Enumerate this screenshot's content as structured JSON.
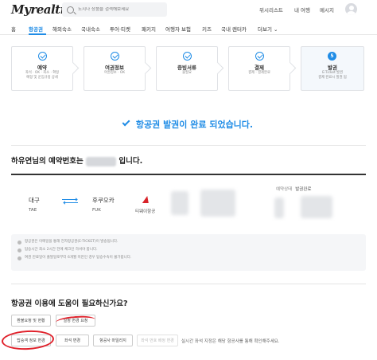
{
  "header": {
    "logo": "Myrealtrip",
    "search_placeholder": "도시나 상품을 검색해보세요",
    "links": [
      "위시리스트",
      "내 여행",
      "메시지"
    ]
  },
  "nav": {
    "items": [
      "홈",
      "항공권",
      "해외숙소",
      "국내숙소",
      "투어·티켓",
      "패키지",
      "여행자 보험",
      "키즈",
      "국내 렌터카",
      "더보기 ⌄"
    ],
    "active_index": 1
  },
  "steps": [
    {
      "title": "예약",
      "sub": "좌석 · OK · 최소 · 확정\n예형 및 운임규정 상세",
      "state": "done"
    },
    {
      "title": "여권정보",
      "sub": "여권정보 · OK",
      "state": "done"
    },
    {
      "title": "증빙서류",
      "sub": "불필요",
      "state": "done"
    },
    {
      "title": "결제",
      "sub": "결제 · 결제완료",
      "state": "done"
    },
    {
      "title": "발권",
      "sub": "E-Ticket 발권\n결제 완료시 발권 됨",
      "state": "current",
      "marker": "5"
    }
  ],
  "complete_message": "항공권 발권이 완료 되었습니다.",
  "reservation": {
    "title_prefix": "하유연님의 예약번호는",
    "title_suffix": "입니다.",
    "status_label": "예약상태",
    "status_value": "발권완료",
    "from_city": "대구",
    "from_code": "TAE",
    "to_city": "후쿠오카",
    "to_code": "FUK",
    "airline": "티웨이항공"
  },
  "notices": [
    "항공권은 이메일을 통해 전자항공권(E-TICKET)이 발송됩니다.",
    "탑승시간 최소 2시간 전에 체크인 하셔야 합니다.",
    "여권 만료일이 출발일로부터 6개월 미만인 경우 탑승수속이 불가합니다."
  ],
  "help": {
    "title": "항공권 이용에 도움이 필요하신가요?",
    "row1": [
      "환불요청 및 현황",
      "일정 변경 요청"
    ],
    "row2": [
      "탑승객 정보 변경",
      "좌석 변경",
      "항공사 마일리지",
      "좌석 번호 배정 변경"
    ],
    "note": "실시간 좌석 지정은 해당 항공사를 통해 확인해주세요."
  },
  "colors": {
    "accent": "#1f8ce6",
    "annotation": "#e0202a"
  }
}
